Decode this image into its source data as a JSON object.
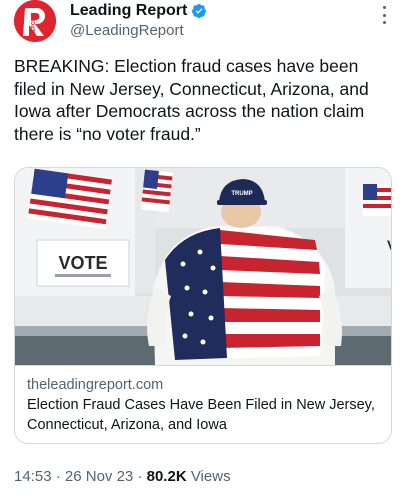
{
  "author": {
    "avatar_text": "REPORT",
    "display_name": "Leading Report",
    "handle": "@LeadingReport",
    "verified_color": "#1d9bf0"
  },
  "tweet": {
    "text": "BREAKING: Election fraud cases have been filed in New Jersey, Connecticut, Arizona, and Iowa after Democrats across the nation claim there is “no voter fraud.”"
  },
  "card": {
    "image_booth_text": "VOTE",
    "image_hat_text": "TRUMP",
    "domain": "theleadingreport.com",
    "title": "Election Fraud Cases Have Been Filed in New Jersey, Connecticut, Arizona, and Iowa"
  },
  "meta": {
    "time": "14:53",
    "separator": "·",
    "date": "26 Nov 23",
    "views_count": "80.2K",
    "views_label": "Views"
  },
  "colors": {
    "brand_red": "#e0242f",
    "secondary_text": "#536471",
    "border": "#cfd9de"
  }
}
